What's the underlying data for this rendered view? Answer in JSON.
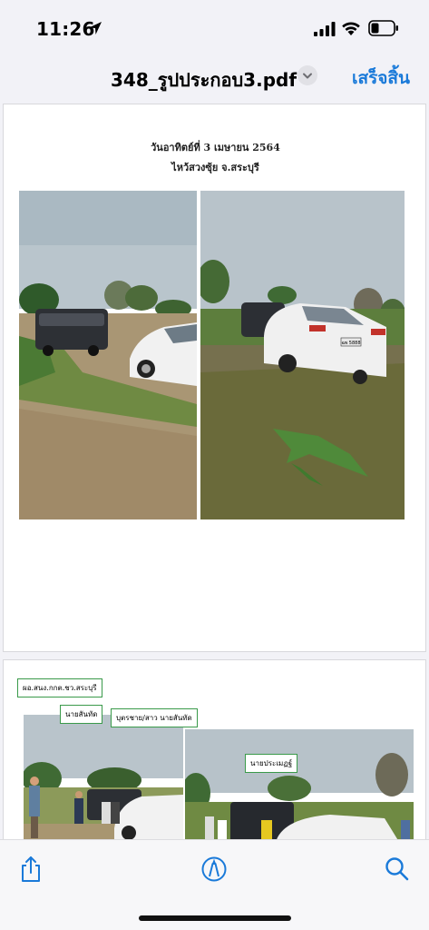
{
  "status_bar": {
    "time": "11:26"
  },
  "nav": {
    "title": "348_รูปประกอบ3.pdf",
    "done_label": "เสร็จสิ้น"
  },
  "page1": {
    "heading_line1": "วันอาทิตย์ที่ 3 เมษายน 2564",
    "heading_line2": "ไหว้สวงซุ้ย จ.สระบุรี",
    "car_plate": "ฉพ 5888"
  },
  "page2": {
    "callouts": [
      "ผอ.สนง.กกต.ชว.สระบุรี",
      "นายสันทัด",
      "บุตรชาย/สาว นายสันทัด",
      "นายประเมฏฐ์"
    ]
  },
  "colors": {
    "accent": "#1a7ad9",
    "callout_border": "#3a9a4a"
  },
  "toolbar": {
    "icons": [
      "share-icon",
      "markup-icon",
      "search-icon"
    ]
  }
}
